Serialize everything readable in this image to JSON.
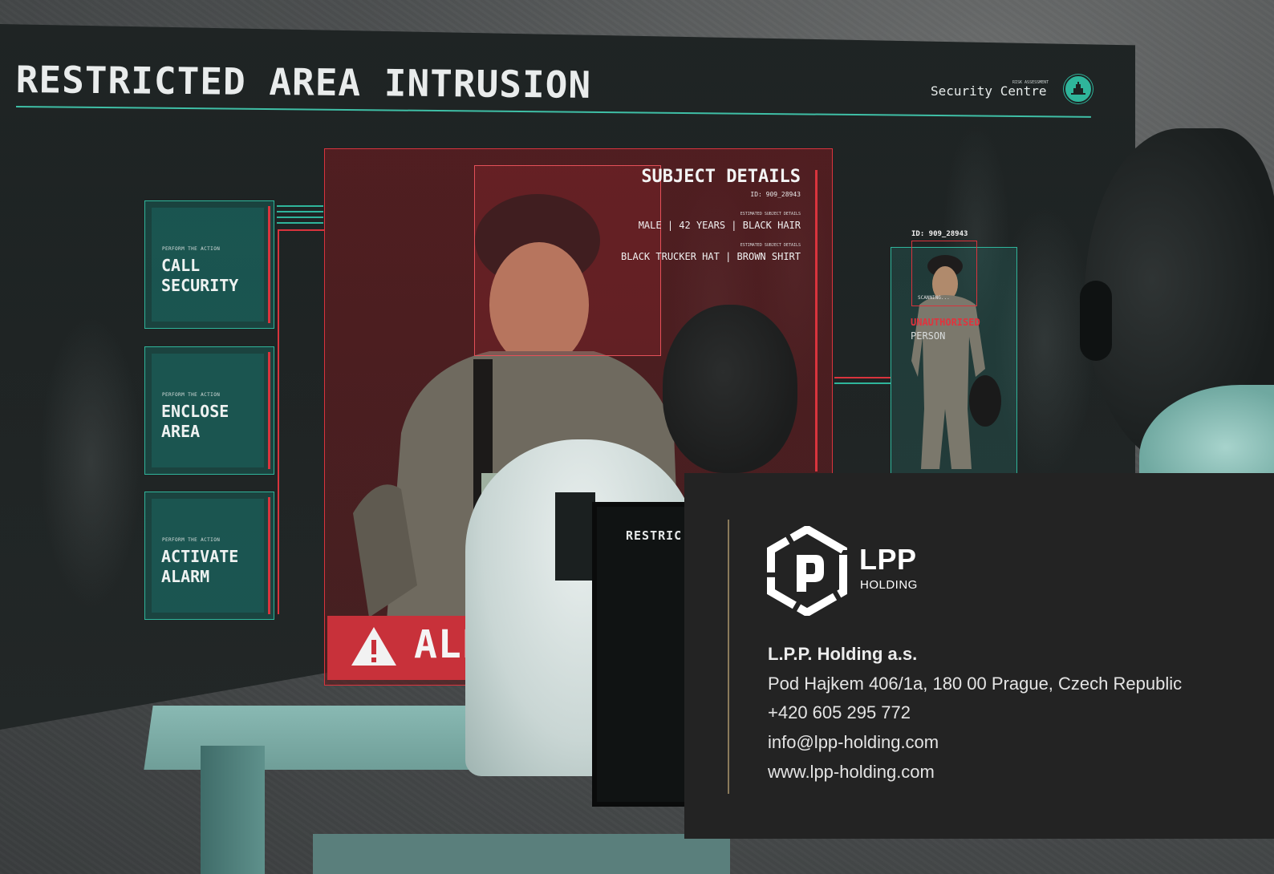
{
  "screen": {
    "title": "RESTRICTED AREA INTRUSION",
    "risk_assessment_label": "RISK ASSESSMENT",
    "centre_label": "Security Centre",
    "icon": "building-icon",
    "accent_color": "#2fb59b",
    "alert_color": "#d9343d"
  },
  "actions": [
    {
      "caption": "PERFORM THE ACTION",
      "label": "CALL SECURITY"
    },
    {
      "caption": "PERFORM THE ACTION",
      "label": "ENCLOSE AREA"
    },
    {
      "caption": "PERFORM THE ACTION",
      "label": "ACTIVATE ALARM"
    }
  ],
  "subject": {
    "heading": "SUBJECT DETAILS",
    "id": "ID: 909_28943",
    "estimate_caption_1": "ESTIMATED SUBJECT DETAILS",
    "details_1": "MALE | 42 YEARS | BLACK HAIR",
    "estimate_caption_2": "ESTIMATED SUBJECT DETAILS",
    "details_2": "BLACK TRUCKER HAT | BROWN SHIRT"
  },
  "alert": {
    "text": "ALERT",
    "icon": "warning-triangle-icon"
  },
  "tracking": {
    "id": "ID: 909_28943",
    "status": "SCANNING...",
    "classification": "UNAUTHORISED",
    "classification_sub": "PERSON"
  },
  "operator_monitor": {
    "text": "RESTRIC"
  },
  "card": {
    "logo_word": "LPP",
    "logo_sub": "HOLDING",
    "logo_icon": "lpp-hexagon-logo",
    "company": "L.P.P. Holding a.s.",
    "address": "Pod Hajkem 406/1a, 180 00 Prague, Czech Republic",
    "phone": "+420 605 295 772",
    "email": "info@lpp-holding.com",
    "website": "www.lpp-holding.com"
  }
}
